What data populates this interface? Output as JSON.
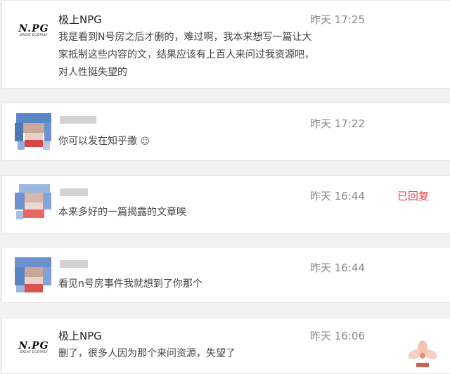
{
  "comments": [
    {
      "author": "极上NPG",
      "time": "昨天 17:25",
      "text": "我是看到N号房之后才删的，难过啊，我本来想写一篇让大家抵制这些内容的文，结果应该有上百人来问过我资源吧，对人性挺失望的",
      "reply_tag": ""
    },
    {
      "author": "",
      "time": "昨天 17:22",
      "text": "你可以发在知乎撒",
      "emoji_icon": "smile-emoji-icon",
      "reply_tag": ""
    },
    {
      "author": "",
      "time": "昨天 16:44",
      "text": "本来多好的一篇揭露的文章唉",
      "reply_tag": "已回复"
    },
    {
      "author": "",
      "time": "昨天 16:44",
      "text": "看见n号房事件我就想到了你那个",
      "reply_tag": ""
    },
    {
      "author": "极上NPG",
      "time": "昨天 16:06",
      "text": "删了，很多人因为那个来问资源，失望了",
      "reply_tag": ""
    }
  ],
  "logo": {
    "main": "NPG",
    "sub": "GREAT ECSTASY"
  },
  "colors": {
    "background": "#f2f2f2",
    "card": "#ffffff",
    "time": "#888888",
    "reply_tag": "#e0484b"
  }
}
